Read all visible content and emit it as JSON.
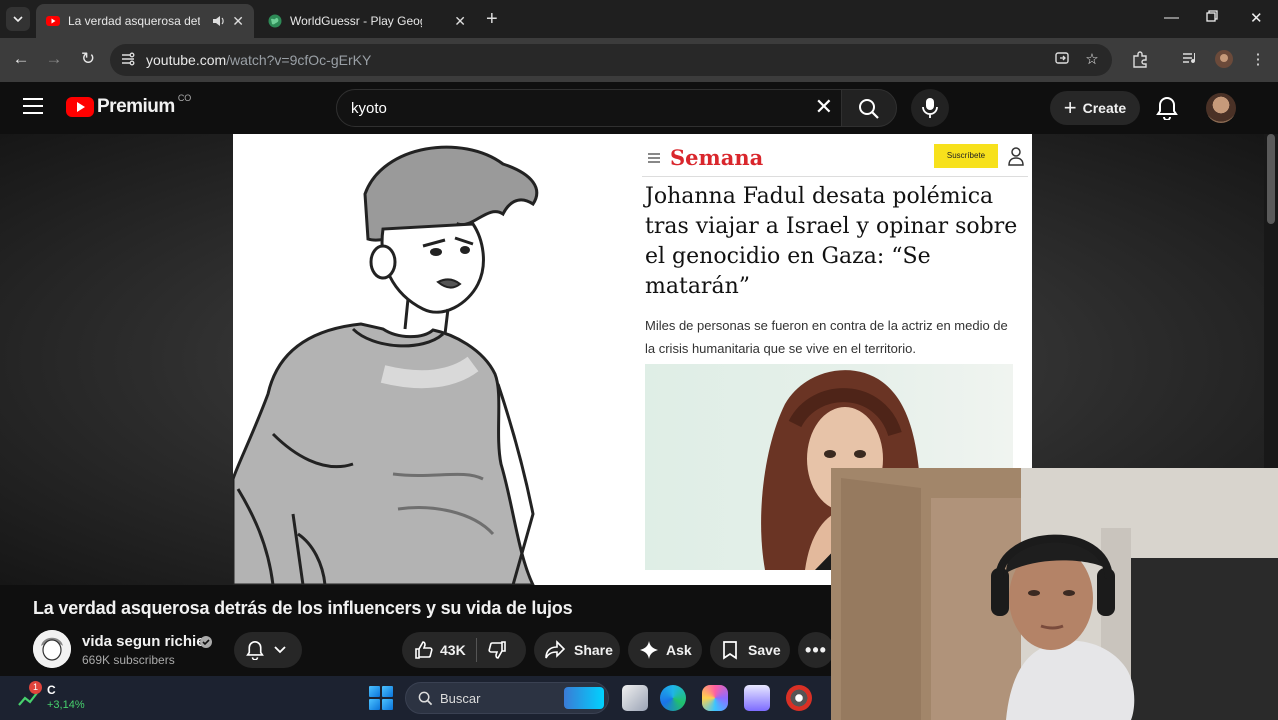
{
  "browser": {
    "tabs": [
      {
        "title": "La verdad asquerosa detrás",
        "active": true,
        "audio": true
      },
      {
        "title": "WorldGuessr - Play Geoguessr",
        "active": false
      }
    ],
    "url_host": "youtube.com",
    "url_path": "/watch?v=9cfOc-gErKY"
  },
  "youtube": {
    "logo_text": "Premium",
    "country_code": "CO",
    "search_query": "kyoto",
    "create_label": "Create"
  },
  "video": {
    "title": "La verdad asquerosa detrás de los influencers y su vida de lujos",
    "channel_name": "vida segun richie",
    "subscribers": "669K subscribers",
    "likes": "43K",
    "share_label": "Share",
    "ask_label": "Ask",
    "save_label": "Save"
  },
  "article": {
    "brand": "Semana",
    "subscribe_label": "Suscríbete",
    "headline": "Johanna Fadul desata polémica tras viajar a Israel y opinar sobre el genocidio en Gaza: “Se matarán”",
    "lede": "Miles de personas se fueron en contra de la actriz en medio de la crisis humanitaria que se vive en el territorio."
  },
  "taskbar": {
    "widget_badge": "1",
    "widget_label": "C",
    "widget_change": "+3,14%",
    "search_placeholder": "Buscar"
  },
  "colors": {
    "brand_red": "#ff0000",
    "semana_red": "#d9262c",
    "subscribe_yellow": "#f7e11c",
    "page_bg": "#0f0f0f"
  }
}
